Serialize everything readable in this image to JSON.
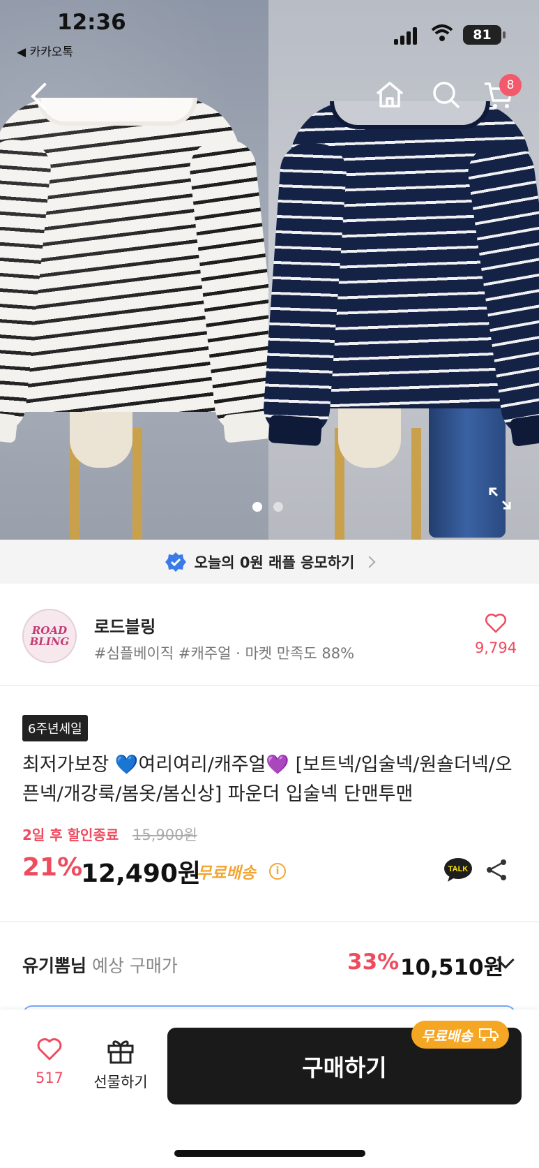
{
  "status": {
    "time": "12:36",
    "back_app": "◀ 카카오톡",
    "battery": "81"
  },
  "nav": {
    "cart_badge": "8"
  },
  "banner": {
    "text": "오늘의 0원 래플 응모하기"
  },
  "store": {
    "name": "로드블링",
    "logo_line1": "ROAD",
    "logo_line2": "BLING",
    "tags": "#심플베이직 #캐주얼 · 마켓 만족도 88%",
    "like_count": "9,794"
  },
  "product": {
    "badge": "6주년세일",
    "title": "최저가보장 💙여리여리/캐주얼💜 [보트넥/입술넥/원숄더넥/오픈넥/개강룩/봄옷/봄신상] 파운더 입술넥 단맨투맨",
    "sale_end": "2일 후 할인종료",
    "original_price": "15,900원",
    "discount": "21%",
    "price": "12,490원",
    "shipping": "무료배송",
    "talk_label": "TALK"
  },
  "member_price": {
    "name": "유기뽐님",
    "label": " 예상 구매가",
    "discount": "33%",
    "price": "10,510원"
  },
  "bottom_bar": {
    "wish_count": "517",
    "gift_label": "선물하기",
    "buy_label": "구매하기",
    "shipping_badge": "무료배송"
  },
  "colors": {
    "accent_red": "#ef4b5f",
    "shipping_orange": "#f3a531",
    "buy_button": "#1a1a1a"
  }
}
